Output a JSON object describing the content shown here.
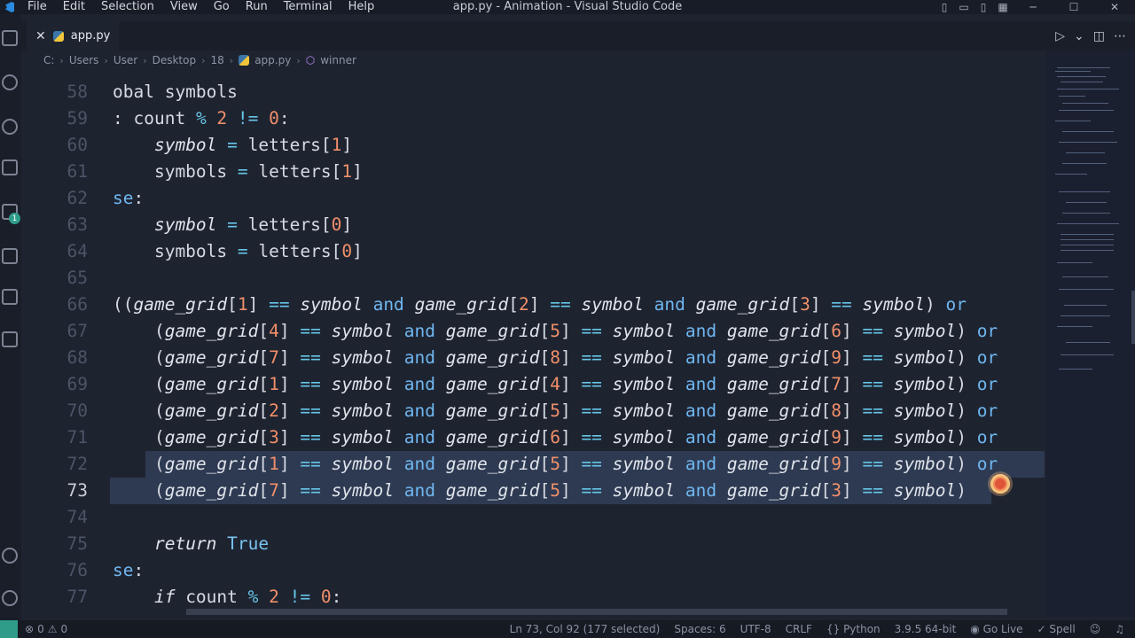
{
  "menu": [
    "File",
    "Edit",
    "Selection",
    "View",
    "Go",
    "Run",
    "Terminal",
    "Help"
  ],
  "window_title": "app.py - Animation - Visual Studio Code",
  "tab": {
    "label": "app.py",
    "close": "✕"
  },
  "activity_badge": "1",
  "breadcrumb": [
    "C:",
    "Users",
    "User",
    "Desktop",
    "18",
    "app.py",
    "winner"
  ],
  "code_lines": [
    {
      "ln": "58",
      "html": "<span class='c'>obal symbols</span>"
    },
    {
      "ln": "59",
      "html": "<span class='c'>: </span><span class='c'>count </span><span class='o'>% </span><span class='n'>2 </span><span class='o'>!= </span><span class='n'>0</span><span class='c'>:</span>"
    },
    {
      "ln": "60",
      "html": "<span class='c'>    </span><span class='v'>symbol</span><span class='c'> </span><span class='o'>=</span><span class='c'> letters[</span><span class='n'>1</span><span class='c'>]</span>"
    },
    {
      "ln": "61",
      "html": "<span class='c'>    symbols </span><span class='o'>=</span><span class='c'> letters[</span><span class='n'>1</span><span class='c'>]</span>"
    },
    {
      "ln": "62",
      "html": "<span class='k'>se</span><span class='c'>:</span>"
    },
    {
      "ln": "63",
      "html": "<span class='c'>    </span><span class='v'>symbol</span><span class='c'> </span><span class='o'>=</span><span class='c'> letters[</span><span class='n'>0</span><span class='c'>]</span>"
    },
    {
      "ln": "64",
      "html": "<span class='c'>    symbols </span><span class='o'>=</span><span class='c'> letters[</span><span class='n'>0</span><span class='c'>]</span>"
    },
    {
      "ln": "65",
      "html": ""
    },
    {
      "ln": "66",
      "html": "<span class='c'>((</span><span class='v'>game_grid</span><span class='c'>[</span><span class='n'>1</span><span class='c'>] </span><span class='o'>==</span><span class='c'> </span><span class='v'>symbol</span><span class='c'> </span><span class='k'>and</span><span class='c'> </span><span class='v'>game_grid</span><span class='c'>[</span><span class='n'>2</span><span class='c'>] </span><span class='o'>==</span><span class='c'> </span><span class='v'>symbol</span><span class='c'> </span><span class='k'>and</span><span class='c'> </span><span class='v'>game_grid</span><span class='c'>[</span><span class='n'>3</span><span class='c'>] </span><span class='o'>==</span><span class='c'> </span><span class='v'>symbol</span><span class='c'>) </span><span class='k'>or</span>"
    },
    {
      "ln": "67",
      "html": "<span class='c'>    (</span><span class='v'>game_grid</span><span class='c'>[</span><span class='n'>4</span><span class='c'>] </span><span class='o'>==</span><span class='c'> </span><span class='v'>symbol</span><span class='c'> </span><span class='k'>and</span><span class='c'> </span><span class='v'>game_grid</span><span class='c'>[</span><span class='n'>5</span><span class='c'>] </span><span class='o'>==</span><span class='c'> </span><span class='v'>symbol</span><span class='c'> </span><span class='k'>and</span><span class='c'> </span><span class='v'>game_grid</span><span class='c'>[</span><span class='n'>6</span><span class='c'>] </span><span class='o'>==</span><span class='c'> </span><span class='v'>symbol</span><span class='c'>) </span><span class='k'>or</span>"
    },
    {
      "ln": "68",
      "html": "<span class='c'>    (</span><span class='v'>game_grid</span><span class='c'>[</span><span class='n'>7</span><span class='c'>] </span><span class='o'>==</span><span class='c'> </span><span class='v'>symbol</span><span class='c'> </span><span class='k'>and</span><span class='c'> </span><span class='v'>game_grid</span><span class='c'>[</span><span class='n'>8</span><span class='c'>] </span><span class='o'>==</span><span class='c'> </span><span class='v'>symbol</span><span class='c'> </span><span class='k'>and</span><span class='c'> </span><span class='v'>game_grid</span><span class='c'>[</span><span class='n'>9</span><span class='c'>] </span><span class='o'>==</span><span class='c'> </span><span class='v'>symbol</span><span class='c'>) </span><span class='k'>or</span>"
    },
    {
      "ln": "69",
      "html": "<span class='c'>    (</span><span class='v'>game_grid</span><span class='c'>[</span><span class='n'>1</span><span class='c'>] </span><span class='o'>==</span><span class='c'> </span><span class='v'>symbol</span><span class='c'> </span><span class='k'>and</span><span class='c'> </span><span class='v'>game_grid</span><span class='c'>[</span><span class='n'>4</span><span class='c'>] </span><span class='o'>==</span><span class='c'> </span><span class='v'>symbol</span><span class='c'> </span><span class='k'>and</span><span class='c'> </span><span class='v'>game_grid</span><span class='c'>[</span><span class='n'>7</span><span class='c'>] </span><span class='o'>==</span><span class='c'> </span><span class='v'>symbol</span><span class='c'>) </span><span class='k'>or</span>"
    },
    {
      "ln": "70",
      "html": "<span class='c'>    (</span><span class='v'>game_grid</span><span class='c'>[</span><span class='n'>2</span><span class='c'>] </span><span class='o'>==</span><span class='c'> </span><span class='v'>symbol</span><span class='c'> </span><span class='k'>and</span><span class='c'> </span><span class='v'>game_grid</span><span class='c'>[</span><span class='n'>5</span><span class='c'>] </span><span class='o'>==</span><span class='c'> </span><span class='v'>symbol</span><span class='c'> </span><span class='k'>and</span><span class='c'> </span><span class='v'>game_grid</span><span class='c'>[</span><span class='n'>8</span><span class='c'>] </span><span class='o'>==</span><span class='c'> </span><span class='v'>symbol</span><span class='c'>) </span><span class='k'>or</span>"
    },
    {
      "ln": "71",
      "html": "<span class='c'>    (</span><span class='v'>game_grid</span><span class='c'>[</span><span class='n'>3</span><span class='c'>] </span><span class='o'>==</span><span class='c'> </span><span class='v'>symbol</span><span class='c'> </span><span class='k'>and</span><span class='c'> </span><span class='v'>game_grid</span><span class='c'>[</span><span class='n'>6</span><span class='c'>] </span><span class='o'>==</span><span class='c'> </span><span class='v'>symbol</span><span class='c'> </span><span class='k'>and</span><span class='c'> </span><span class='v'>game_grid</span><span class='c'>[</span><span class='n'>9</span><span class='c'>] </span><span class='o'>==</span><span class='c'> </span><span class='v'>symbol</span><span class='c'>) </span><span class='k'>or</span>"
    },
    {
      "ln": "72",
      "html": "<span class='c'>    (</span><span class='v'>game_grid</span><span class='c'>[</span><span class='n'>1</span><span class='c'>] </span><span class='o'>==</span><span class='c'> </span><span class='v'>symbol</span><span class='c'> </span><span class='k'>and</span><span class='c'> </span><span class='v'>game_grid</span><span class='c'>[</span><span class='n'>5</span><span class='c'>] </span><span class='o'>==</span><span class='c'> </span><span class='v'>symbol</span><span class='c'> </span><span class='k'>and</span><span class='c'> </span><span class='v'>game_grid</span><span class='c'>[</span><span class='n'>9</span><span class='c'>] </span><span class='o'>==</span><span class='c'> </span><span class='v'>symbol</span><span class='c'>) </span><span class='k'>or</span>"
    },
    {
      "ln": "73",
      "html": "<span class='c'>    (</span><span class='v'>game_grid</span><span class='c'>[</span><span class='n'>7</span><span class='c'>] </span><span class='o'>==</span><span class='c'> </span><span class='v'>symbol</span><span class='c'> </span><span class='k'>and</span><span class='c'> </span><span class='v'>game_grid</span><span class='c'>[</span><span class='n'>5</span><span class='c'>] </span><span class='o'>==</span><span class='c'> </span><span class='v'>symbol</span><span class='c'> </span><span class='k'>and</span><span class='c'> </span><span class='v'>game_grid</span><span class='c'>[</span><span class='n'>3</span><span class='c'>] </span><span class='o'>==</span><span class='c'> </span><span class='v'>symbol</span><span class='c'>)</span>"
    },
    {
      "ln": "74",
      "html": ""
    },
    {
      "ln": "75",
      "html": "<span class='c'>    </span><span class='v'>return</span><span class='c'> </span><span class='t'>True</span>"
    },
    {
      "ln": "76",
      "html": "<span class='k'>se</span><span class='c'>:</span>"
    },
    {
      "ln": "77",
      "html": "<span class='c'>    </span><span class='v'>if</span><span class='c'> count </span><span class='o'>%</span><span class='c'> </span><span class='n'>2</span><span class='c'> </span><span class='o'>!=</span><span class='c'> </span><span class='n'>0</span><span class='c'>:</span>"
    }
  ],
  "current_line": "73",
  "status": {
    "errors": "0",
    "warnings": "0",
    "position": "Ln 73, Col 92 (177 selected)",
    "spaces": "Spaces: 6",
    "encoding": "UTF-8",
    "eol": "CRLF",
    "language": "Python",
    "interpreter": "3.9.5 64-bit",
    "golive": "Go Live",
    "spell": "Spell"
  },
  "colors": {
    "accent": "#2f9c8a",
    "keyword": "#6fb7f0",
    "number": "#f0906a",
    "selection": "#2e3a52"
  }
}
